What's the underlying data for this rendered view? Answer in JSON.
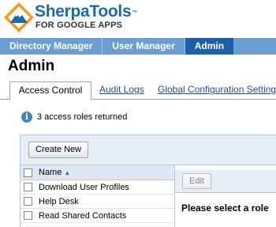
{
  "logo": {
    "name": "SherpaTools",
    "trademark": "™",
    "subtitle": "FOR GOOGLE APPS",
    "colors": {
      "mark_outer": "#f29b1d",
      "mark_mountain": "#1c6aa8",
      "name": "#1c6aa8"
    }
  },
  "nav": {
    "items": [
      {
        "label": "Directory Manager",
        "active": false
      },
      {
        "label": "User Manager",
        "active": false
      },
      {
        "label": "Admin",
        "active": true
      }
    ],
    "colors": {
      "bar": "#6a9fd4",
      "active": "#1d5fa8"
    }
  },
  "page": {
    "title": "Admin"
  },
  "tabs": [
    {
      "label": "Access Control",
      "active": true
    },
    {
      "label": "Audit Logs",
      "active": false
    },
    {
      "label": "Global Configuration Settings",
      "active": false
    }
  ],
  "info": {
    "icon": "info-icon",
    "glyph": "i",
    "text": "3 access roles returned"
  },
  "toolbar": {
    "create_label": "Create New"
  },
  "list": {
    "header_label": "Name",
    "sort_indicator": "▲",
    "rows": [
      {
        "label": "Download User Profiles"
      },
      {
        "label": "Help Desk"
      },
      {
        "label": "Read Shared Contacts"
      }
    ]
  },
  "detail": {
    "edit_label": "Edit",
    "message": "Please select a role"
  }
}
